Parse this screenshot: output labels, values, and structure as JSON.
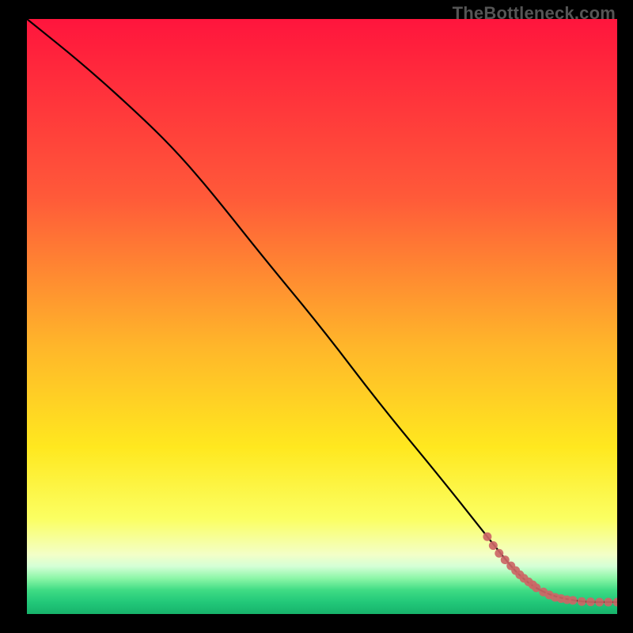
{
  "attribution": "TheBottleneck.com",
  "chart_data": {
    "type": "line",
    "title": "",
    "xlabel": "",
    "ylabel": "",
    "xlim": [
      0,
      100
    ],
    "ylim": [
      0,
      100
    ],
    "gradient_stops": [
      {
        "offset": 0,
        "color": "#ff153d"
      },
      {
        "offset": 30,
        "color": "#ff5a39"
      },
      {
        "offset": 55,
        "color": "#ffb62a"
      },
      {
        "offset": 72,
        "color": "#ffe81f"
      },
      {
        "offset": 84,
        "color": "#fbff62"
      },
      {
        "offset": 90,
        "color": "#f3ffc7"
      },
      {
        "offset": 92,
        "color": "#d4ffd6"
      },
      {
        "offset": 94,
        "color": "#8cf6a7"
      },
      {
        "offset": 96,
        "color": "#3fdc84"
      },
      {
        "offset": 98,
        "color": "#22c879"
      },
      {
        "offset": 100,
        "color": "#17b36b"
      }
    ],
    "series": [
      {
        "name": "bottleneck-curve",
        "color": "#000000",
        "x": [
          0,
          10,
          20,
          26,
          32,
          40,
          50,
          60,
          70,
          78,
          82,
          84,
          86,
          88,
          90,
          92,
          94,
          96,
          98,
          100
        ],
        "y": [
          100,
          92,
          83,
          77,
          70,
          60,
          48,
          35,
          23,
          13,
          8,
          6,
          4.5,
          3.5,
          2.8,
          2.4,
          2.1,
          2.0,
          2.0,
          2.0
        ]
      }
    ],
    "points": {
      "name": "data-points",
      "color": "#cc6666",
      "radius": 5.5,
      "x": [
        78,
        79,
        80,
        81,
        82,
        82.8,
        83.5,
        84.2,
        85,
        85.7,
        86.3,
        87.5,
        88.5,
        89.5,
        90.5,
        91.5,
        92.5,
        94,
        95.5,
        97,
        98.5,
        100
      ],
      "y": [
        13,
        11.5,
        10.2,
        9.1,
        8.1,
        7.3,
        6.6,
        6.0,
        5.4,
        4.9,
        4.4,
        3.7,
        3.2,
        2.8,
        2.6,
        2.4,
        2.3,
        2.1,
        2.05,
        2.0,
        2.0,
        2.0
      ]
    }
  }
}
